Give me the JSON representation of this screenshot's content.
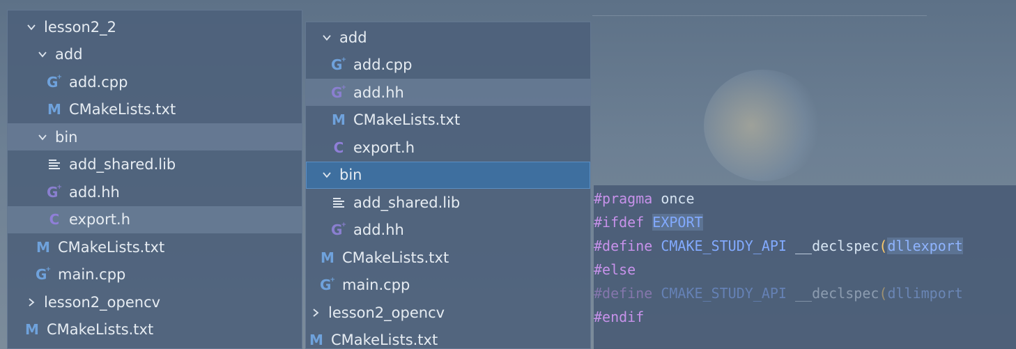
{
  "left_tree": [
    {
      "label": "lesson2_2",
      "kind": "folder",
      "open": true,
      "depth": 1
    },
    {
      "label": "add",
      "kind": "folder",
      "open": true,
      "depth": 2
    },
    {
      "label": "add.cpp",
      "kind": "cpp",
      "depth": 3,
      "icon": "cpp-file-icon"
    },
    {
      "label": "CMakeLists.txt",
      "kind": "cmake",
      "depth": 3,
      "icon": "cmake-file-icon"
    },
    {
      "label": "bin",
      "kind": "folder",
      "open": true,
      "depth": 2,
      "state": "hover"
    },
    {
      "label": "add_shared.lib",
      "kind": "txt",
      "depth": 3,
      "icon": "text-file-icon"
    },
    {
      "label": "add.hh",
      "kind": "hh",
      "depth": 3,
      "icon": "cpp-header-icon"
    },
    {
      "label": "export.h",
      "kind": "c",
      "depth": 3,
      "icon": "c-header-icon",
      "state": "hover"
    },
    {
      "label": "CMakeLists.txt",
      "kind": "cmake",
      "depth": 2,
      "icon": "cmake-file-icon"
    },
    {
      "label": "main.cpp",
      "kind": "cpp",
      "depth": 2,
      "icon": "cpp-file-icon"
    },
    {
      "label": "lesson2_opencv",
      "kind": "folder",
      "open": false,
      "depth": 1
    },
    {
      "label": "CMakeLists.txt",
      "kind": "cmake",
      "depth": 1,
      "icon": "cmake-file-icon"
    }
  ],
  "mid_tree": [
    {
      "label": "add",
      "kind": "folder",
      "open": true,
      "depth": 2
    },
    {
      "label": "add.cpp",
      "kind": "cpp",
      "depth": 3,
      "icon": "cpp-file-icon"
    },
    {
      "label": "add.hh",
      "kind": "hh",
      "depth": 3,
      "icon": "cpp-header-icon",
      "state": "hover"
    },
    {
      "label": "CMakeLists.txt",
      "kind": "cmake",
      "depth": 3,
      "icon": "cmake-file-icon"
    },
    {
      "label": "export.h",
      "kind": "c",
      "depth": 3,
      "icon": "c-header-icon"
    },
    {
      "label": "bin",
      "kind": "folder",
      "open": true,
      "depth": 2,
      "state": "selected"
    },
    {
      "label": "add_shared.lib",
      "kind": "txt",
      "depth": 3,
      "icon": "text-file-icon"
    },
    {
      "label": "add.hh",
      "kind": "hh",
      "depth": 3,
      "icon": "cpp-header-icon"
    },
    {
      "label": "CMakeLists.txt",
      "kind": "cmake",
      "depth": 2,
      "icon": "cmake-file-icon"
    },
    {
      "label": "main.cpp",
      "kind": "cpp",
      "depth": 2,
      "icon": "cpp-file-icon"
    },
    {
      "label": "lesson2_opencv",
      "kind": "folder",
      "open": false,
      "depth": 1
    },
    {
      "label": "CMakeLists.txt",
      "kind": "cmake",
      "depth": 1,
      "icon": "cmake-file-icon"
    }
  ],
  "code": [
    {
      "tokens": [
        {
          "t": "#pragma",
          "c": "kw"
        },
        {
          "t": " ",
          "c": "id"
        },
        {
          "t": "once",
          "c": "id"
        }
      ]
    },
    {
      "tokens": [
        {
          "t": "#ifdef",
          "c": "kw"
        },
        {
          "t": " ",
          "c": "id"
        },
        {
          "t": "EXPORT",
          "c": "mac boxed"
        }
      ]
    },
    {
      "tokens": [
        {
          "t": "#define",
          "c": "kw"
        },
        {
          "t": " ",
          "c": "id"
        },
        {
          "t": "CMAKE_STUDY_API",
          "c": "mac"
        },
        {
          "t": " __declspec",
          "c": "id"
        },
        {
          "t": "(",
          "c": "paren"
        },
        {
          "t": "dllexport",
          "c": "mac2 boxed"
        }
      ]
    },
    {
      "tokens": [
        {
          "t": "#else",
          "c": "kw"
        }
      ]
    },
    {
      "dim": true,
      "tokens": [
        {
          "t": "#define",
          "c": "kw"
        },
        {
          "t": " ",
          "c": "id"
        },
        {
          "t": "CMAKE_STUDY_API",
          "c": "mac"
        },
        {
          "t": " __declspec",
          "c": "id"
        },
        {
          "t": "(",
          "c": "paren"
        },
        {
          "t": "dllimport",
          "c": "mac2"
        }
      ]
    },
    {
      "tokens": [
        {
          "t": "#endif",
          "c": "kw"
        }
      ]
    }
  ],
  "colors": {
    "panel": "#4c607a",
    "selected_row": "#3e6f9f",
    "keyword": "#c792ea",
    "macro": "#82aaff",
    "paren": "#ffcb6b",
    "cpp_icon": "#6fa2dc",
    "header_icon": "#8a7fd0"
  }
}
